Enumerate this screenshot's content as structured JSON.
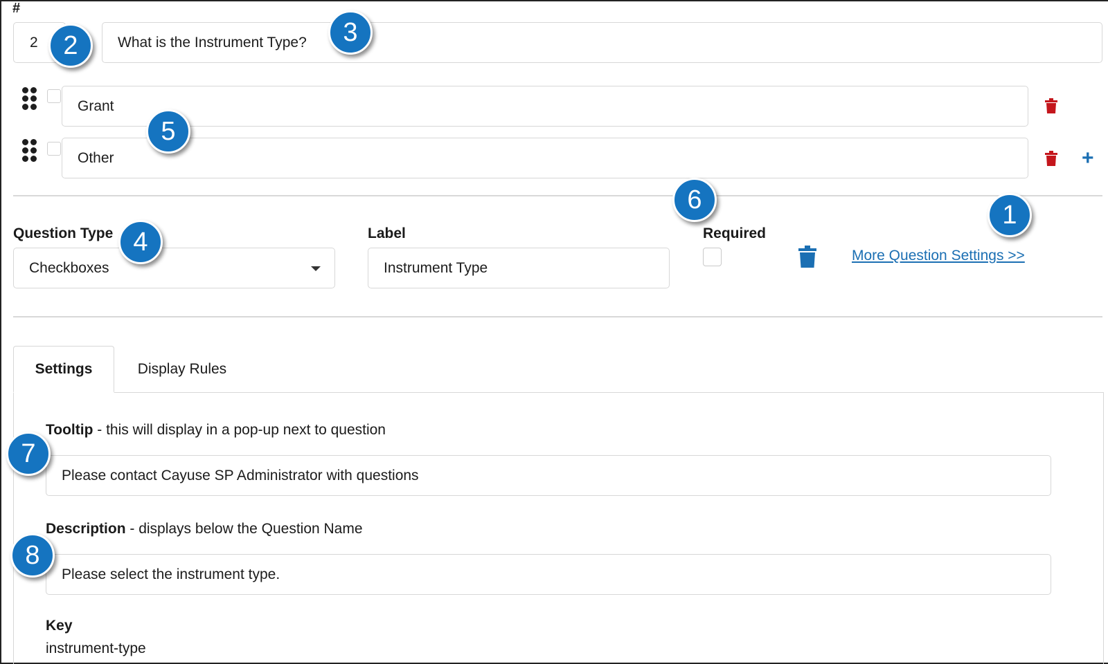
{
  "header": {
    "hash_label": "#"
  },
  "question": {
    "number": "2",
    "text": "What is the Instrument Type?"
  },
  "options": [
    {
      "value": "Grant"
    },
    {
      "value": "Other"
    }
  ],
  "question_type": {
    "label": "Question Type",
    "selected": "Checkboxes"
  },
  "label_field": {
    "label": "Label",
    "value": "Instrument Type"
  },
  "required": {
    "label": "Required",
    "checked": false
  },
  "more_settings_link": "More Question Settings >>",
  "tabs": [
    {
      "label": "Settings",
      "active": true
    },
    {
      "label": "Display Rules",
      "active": false
    }
  ],
  "settings": {
    "tooltip": {
      "label_bold": "Tooltip",
      "label_rest": " - this will display in a pop-up next to question",
      "value": "Please contact Cayuse SP Administrator with questions"
    },
    "description": {
      "label_bold": "Description",
      "label_rest": " - displays below the Question Name",
      "value": "Please select the instrument type."
    },
    "key": {
      "label": "Key",
      "value": "instrument-type"
    }
  },
  "callouts": [
    "1",
    "2",
    "3",
    "4",
    "5",
    "6",
    "7",
    "8"
  ],
  "colors": {
    "accent_blue": "#1574c0",
    "link_blue": "#1b6fb3",
    "delete_red": "#c4161c"
  }
}
